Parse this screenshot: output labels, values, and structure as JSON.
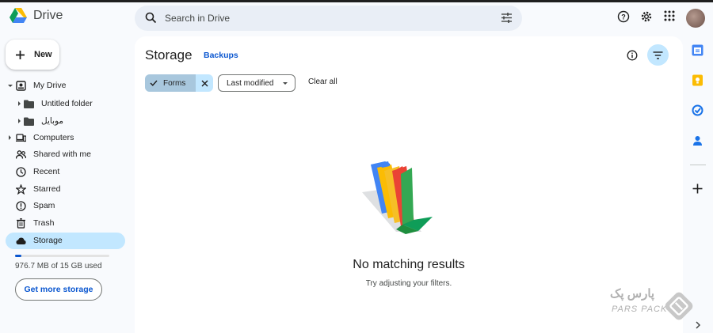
{
  "app": {
    "title": "Drive"
  },
  "search": {
    "placeholder": "Search in Drive"
  },
  "sidebar": {
    "new_label": "New",
    "items": [
      {
        "label": "My Drive",
        "icon": "my-drive-icon"
      },
      {
        "label": "Computers",
        "icon": "computers-icon"
      },
      {
        "label": "Shared with me",
        "icon": "shared-icon"
      },
      {
        "label": "Recent",
        "icon": "clock-icon"
      },
      {
        "label": "Starred",
        "icon": "star-icon"
      },
      {
        "label": "Spam",
        "icon": "spam-icon"
      },
      {
        "label": "Trash",
        "icon": "trash-icon"
      },
      {
        "label": "Storage",
        "icon": "cloud-icon",
        "active": true
      }
    ],
    "subitems": [
      {
        "label": "Untitled folder",
        "icon": "folder-icon"
      },
      {
        "label": "موبایل",
        "icon": "folder-icon"
      }
    ],
    "storage_used_fraction": 0.065,
    "storage_text": "976.7 MB of 15 GB used",
    "get_more_label": "Get more storage"
  },
  "main": {
    "title": "Storage",
    "backups_label": "Backups",
    "filters": {
      "type_chip": "Forms",
      "modified_chip": "Last modified",
      "clear_label": "Clear all"
    },
    "empty_title": "No matching results",
    "empty_subtitle": "Try adjusting your filters."
  },
  "watermark": {
    "fa": "پارس پک",
    "en": "PARS PACK"
  },
  "colors": {
    "accent": "#0b57d0",
    "active_bg": "#c2e7ff",
    "panel_bg": "#f8fafd"
  }
}
